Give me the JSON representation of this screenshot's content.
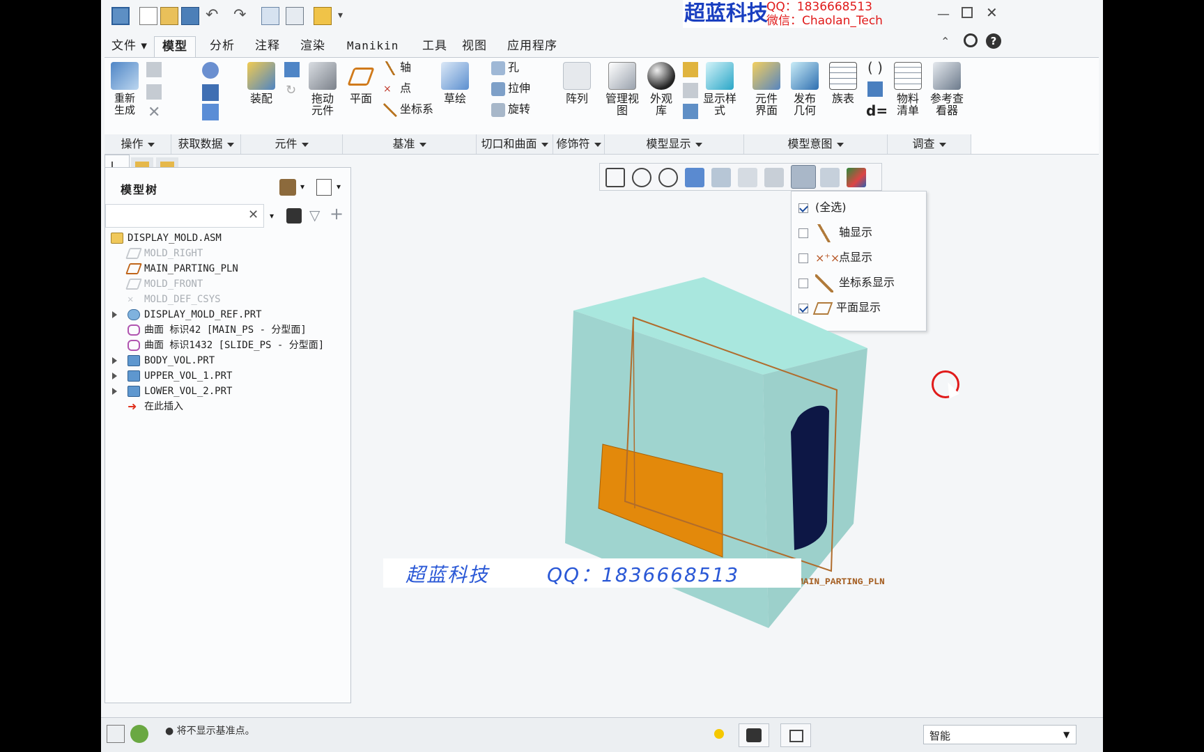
{
  "watermark": {
    "brand": "超蓝科技",
    "qq": "QQ：1836668513",
    "wechat": "微信：Chaolan_Tech",
    "bottom_brand": "超蓝科技",
    "bottom_qq": "QQ：1836668513"
  },
  "tabs": [
    "文件 ▾",
    "模型",
    "分析",
    "注释",
    "渲染",
    "Manikin",
    "工具",
    "视图",
    "应用程序"
  ],
  "active_tab": "模型",
  "ribbon": {
    "regenerate": "重新生成",
    "assemble": "装配",
    "drag": "拖动元件",
    "plane": "平面",
    "axis": "轴",
    "point": "点",
    "csys": "坐标系",
    "sketch": "草绘",
    "hole": "孔",
    "extrude": "拉伸",
    "revolve": "旋转",
    "pattern": "阵列",
    "manage_views": "管理视图",
    "appearance": "外观库",
    "display_style": "显示样式",
    "component_interface": "元件界面",
    "publish_geometry": "发布几何",
    "family_table": "族表",
    "d_eq": "d=",
    "bom": "物料清单",
    "ref_viewer": "参考查看器"
  },
  "groups": [
    "操作",
    "获取数据",
    "元件",
    "基准",
    "切口和曲面",
    "修饰符",
    "模型显示",
    "模型意图",
    "调查"
  ],
  "tree": {
    "title": "模型树",
    "search_placeholder": "",
    "items": [
      {
        "label": "DISPLAY_MOLD.ASM"
      },
      {
        "label": "MOLD_RIGHT"
      },
      {
        "label": "MAIN_PARTING_PLN"
      },
      {
        "label": "MOLD_FRONT"
      },
      {
        "label": "MOLD_DEF_CSYS"
      },
      {
        "label": "DISPLAY_MOLD_REF.PRT"
      },
      {
        "label": "曲面 标识42 [MAIN_PS - 分型面]"
      },
      {
        "label": "曲面 标识1432 [SLIDE_PS - 分型面]"
      },
      {
        "label": "BODY_VOL.PRT"
      },
      {
        "label": "UPPER_VOL_1.PRT"
      },
      {
        "label": "LOWER_VOL_2.PRT"
      },
      {
        "label": "在此插入"
      }
    ]
  },
  "datum_menu": {
    "items": [
      {
        "label": "(全选)",
        "checked": true
      },
      {
        "label": "轴显示",
        "checked": false
      },
      {
        "label": "点显示",
        "checked": false
      },
      {
        "label": "坐标系显示",
        "checked": false
      },
      {
        "label": "平面显示",
        "checked": true
      }
    ]
  },
  "viewport": {
    "plane_label": "MAIN_PARTING_PLN"
  },
  "status": {
    "message": "● 将不显示基准点。",
    "filter": "智能"
  },
  "colors": {
    "cube_top": "#a9e7de",
    "cube_front": "#9fd4cf",
    "cube_right": "#9cd0cb",
    "orange": "#e3890b",
    "navy": "#0d1745",
    "plane": "#b06c2c"
  }
}
